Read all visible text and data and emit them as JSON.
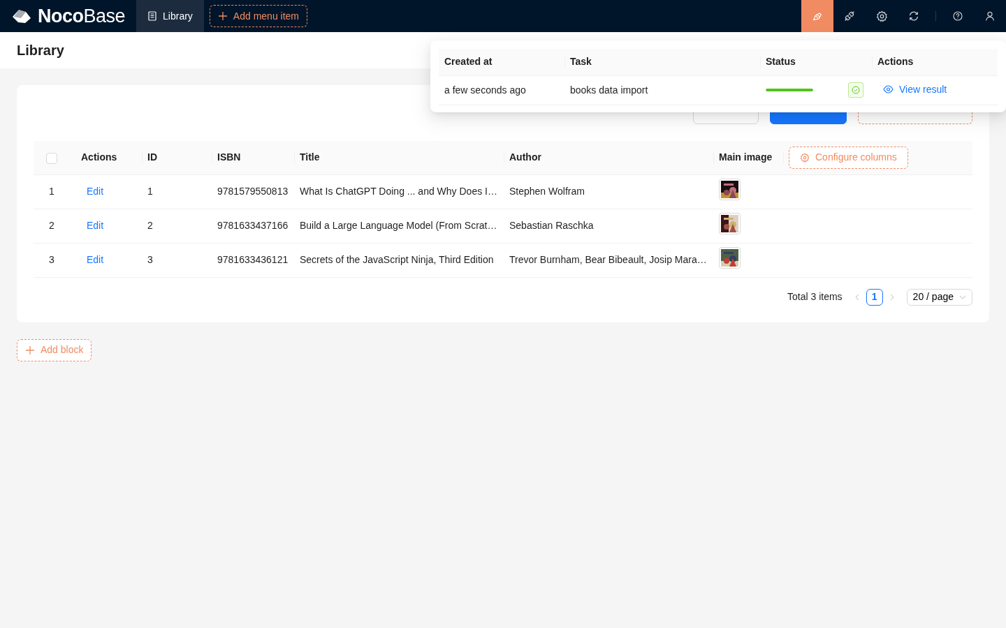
{
  "header": {
    "logo": "**Noco**Base",
    "menu": [
      {
        "label": "Library",
        "selected": true
      }
    ],
    "add_menu_item": "Add menu item",
    "toolbar_icons": [
      {
        "selected": true
      },
      {
        "selected": false
      },
      {
        "selected": false
      },
      {
        "selected": false
      },
      {
        "selected": false
      },
      {
        "selected": false
      }
    ]
  },
  "page_title": "Library",
  "actions": [
    {
      "kind": "import"
    },
    {
      "kind": "add"
    },
    {
      "kind": "configure"
    }
  ],
  "table": {
    "select_all": {
      "checked": false
    },
    "columns": [
      "Actions",
      "ID",
      "ISBN",
      "Title",
      "Author",
      "Main image"
    ],
    "configure_columns": "Configure columns",
    "rows": [
      {
        "number": "1",
        "action": "Edit",
        "id": "1",
        "isbn": "9781579550813",
        "title": "What Is ChatGPT Doing ... and Why Does I…",
        "author": "Stephen Wolfram"
      },
      {
        "number": "2",
        "action": "Edit",
        "id": "2",
        "isbn": "9781633437166",
        "title": "Build a Large Language Model (From Scrat…",
        "author": "Sebastian Raschka"
      },
      {
        "number": "3",
        "action": "Edit",
        "id": "3",
        "isbn": "9781633436121",
        "title": "Secrets of the JavaScript Ninja, Third Edition",
        "author": "Trevor Burnham, Bear Bibeault, Josip Mara…"
      }
    ]
  },
  "pagination": {
    "total": "Total 3 items",
    "pages": [
      {
        "label": "1",
        "selected": true
      }
    ],
    "page_size": "20 / page"
  },
  "add_block": "Add block",
  "tasks_popover": {
    "columns": [
      "Created at",
      "Task",
      "Status",
      "Actions"
    ],
    "rows": [
      {
        "created_at": "a few seconds ago",
        "task": "books data import",
        "status": {
          "level": 1,
          "done": true
        },
        "action": "View result"
      }
    ]
  }
}
